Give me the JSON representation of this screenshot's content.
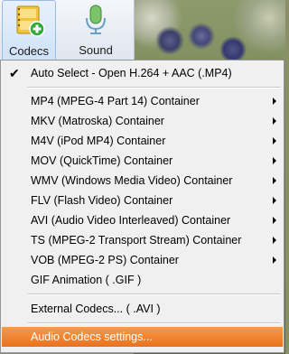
{
  "toolbar": {
    "buttons": [
      {
        "label": "Codecs",
        "icon": "codecs-film-plus-icon"
      },
      {
        "label": "Sound",
        "icon": "microphone-icon"
      }
    ]
  },
  "menu": {
    "items": [
      {
        "label": "Auto Select - Open H.264 + AAC (.MP4)",
        "checked": true,
        "submenu": false
      },
      {
        "label": "MP4 (MPEG-4 Part 14) Container",
        "submenu": true
      },
      {
        "label": "MKV (Matroska) Container",
        "submenu": true
      },
      {
        "label": "M4V (iPod MP4) Container",
        "submenu": true
      },
      {
        "label": "MOV (QuickTime) Container",
        "submenu": true
      },
      {
        "label": "WMV (Windows Media Video) Container",
        "submenu": true
      },
      {
        "label": "FLV (Flash Video) Container",
        "submenu": true
      },
      {
        "label": "AVI (Audio Video Interleaved) Container",
        "submenu": true
      },
      {
        "label": "TS (MPEG-2 Transport Stream) Container",
        "submenu": true
      },
      {
        "label": "VOB (MPEG-2 PS) Container",
        "submenu": true
      },
      {
        "label": "GIF Animation ( .GIF )",
        "submenu": false
      },
      {
        "label": "External Codecs... ( .AVI )",
        "submenu": false
      },
      {
        "label": "Audio Codecs settings...",
        "submenu": false,
        "highlighted": true
      }
    ]
  },
  "colors": {
    "highlight": "#ee7a26",
    "menu_bg": "#f0f0f0"
  }
}
